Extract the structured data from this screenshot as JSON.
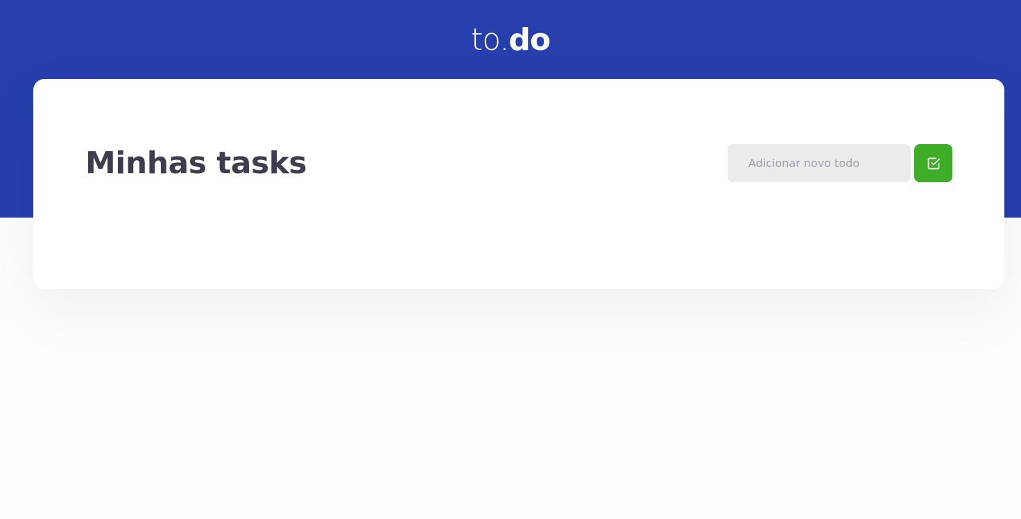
{
  "header": {
    "logo_light": "to.",
    "logo_bold": "do"
  },
  "main": {
    "title": "Minhas tasks",
    "new_todo": {
      "placeholder": "Adicionar novo todo",
      "value": "",
      "submit_icon": "check-square-icon"
    }
  },
  "colors": {
    "header_background": "#273fad",
    "accent_green": "#3fad27",
    "input_background": "#ebebeb",
    "title_text": "#3d3d4d"
  }
}
